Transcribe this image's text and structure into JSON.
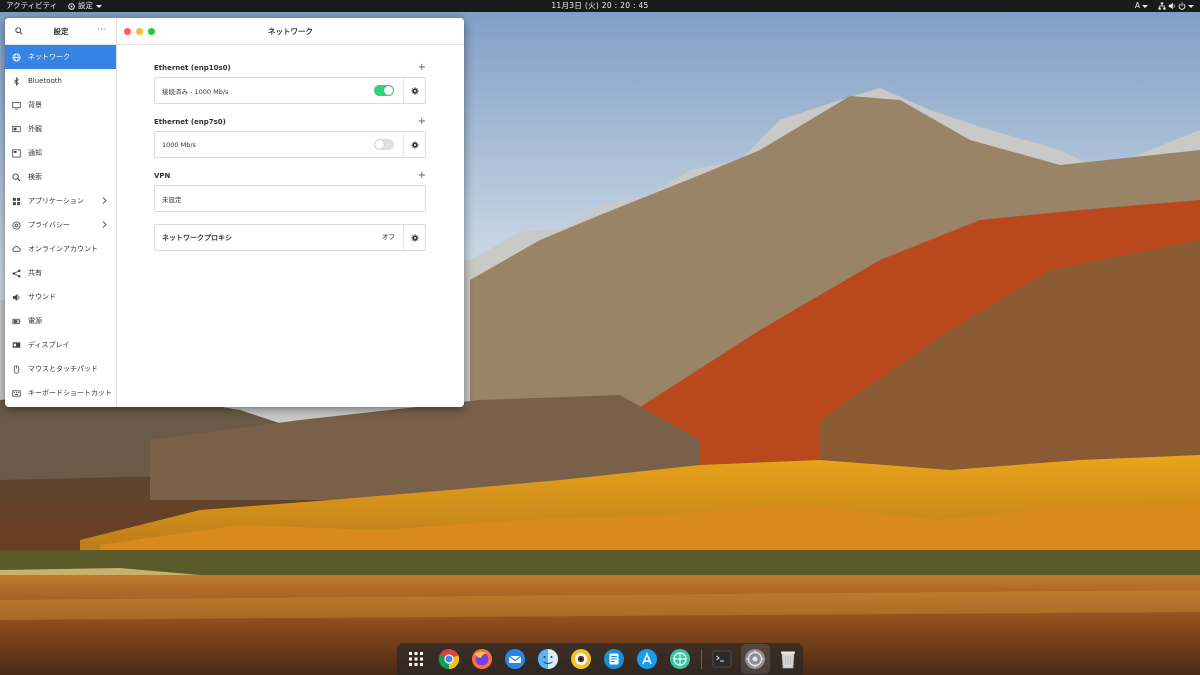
{
  "topbar": {
    "activities": "アクティビティ",
    "app_menu": "設定",
    "clock": "11月3日 (火)  20 : 20 : 45",
    "input_method": "A"
  },
  "sidebar": {
    "title": "設定",
    "more": "···",
    "items": [
      {
        "label": "ネットワーク",
        "icon": "network-icon",
        "active": true
      },
      {
        "label": "Bluetooth",
        "icon": "bluetooth-icon"
      },
      {
        "label": "背景",
        "icon": "background-icon"
      },
      {
        "label": "外観",
        "icon": "appearance-icon"
      },
      {
        "label": "通知",
        "icon": "notifications-icon"
      },
      {
        "label": "検索",
        "icon": "search-icon"
      },
      {
        "label": "アプリケーション",
        "icon": "applications-icon",
        "chevron": true
      },
      {
        "label": "プライバシー",
        "icon": "privacy-icon",
        "chevron": true
      },
      {
        "label": "オンラインアカウント",
        "icon": "online-accounts-icon"
      },
      {
        "label": "共有",
        "icon": "sharing-icon"
      },
      {
        "label": "サウンド",
        "icon": "sound-icon"
      },
      {
        "label": "電源",
        "icon": "power-icon"
      },
      {
        "label": "ディスプレイ",
        "icon": "display-icon"
      },
      {
        "label": "マウスとタッチパッド",
        "icon": "mouse-icon"
      },
      {
        "label": "キーボードショートカット",
        "icon": "keyboard-icon"
      }
    ]
  },
  "main": {
    "title": "ネットワーク",
    "sections": [
      {
        "label": "Ethernet (enp10s0)",
        "add": "+",
        "row": "接続済み - 1000 Mb/s",
        "toggle": "on"
      },
      {
        "label": "Ethernet (enp7s0)",
        "add": "+",
        "row": "1000 Mb/s",
        "toggle": "off"
      },
      {
        "label": "VPN",
        "add": "+",
        "row": "未設定"
      }
    ],
    "proxy": {
      "label": "ネットワークプロキシ",
      "status": "オフ"
    }
  },
  "colors": {
    "accent": "#3584e4",
    "toggle_on": "#33d17a",
    "close": "#fc5f57",
    "minimize": "#fdbc2e",
    "maximize": "#28c840"
  },
  "dock": {
    "items": [
      "app-grid-icon",
      "chrome-icon",
      "firefox-icon",
      "mail-icon",
      "finder-icon",
      "eye-app-icon",
      "notes-icon",
      "app-store-icon",
      "browser-icon",
      "terminal-icon",
      "system-settings-icon",
      "trash-icon"
    ]
  }
}
